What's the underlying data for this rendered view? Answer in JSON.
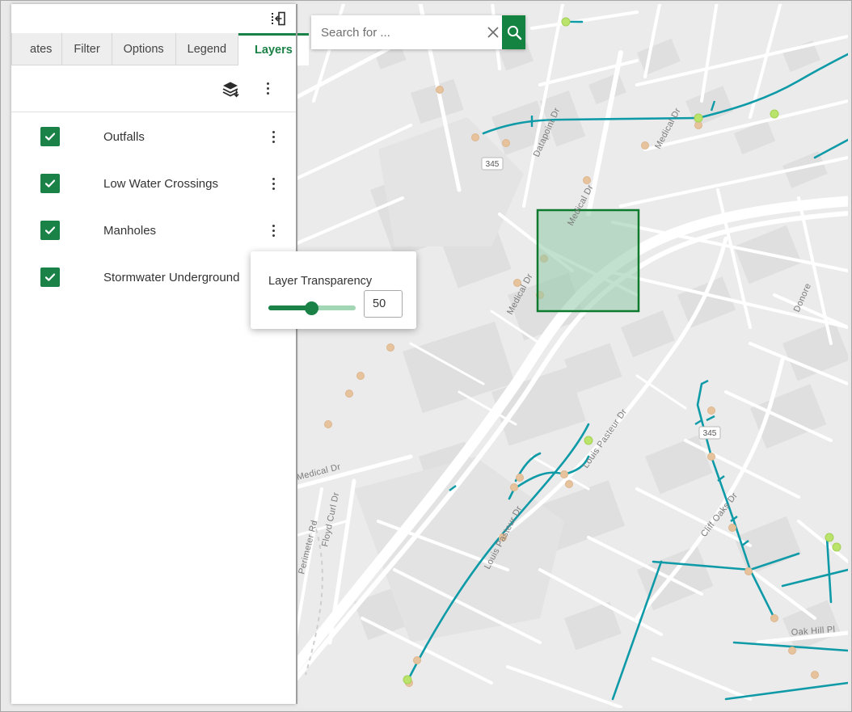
{
  "window": {
    "title": ""
  },
  "panel": {
    "collapse_icon": "collapse-panel-icon",
    "tabs": [
      {
        "label": "ates",
        "active": false,
        "partial": true
      },
      {
        "label": "Filter",
        "active": false
      },
      {
        "label": "Options",
        "active": false
      },
      {
        "label": "Legend",
        "active": false
      },
      {
        "label": "Layers",
        "active": true
      }
    ],
    "scroll_left_icon": "chevron-left-icon",
    "toolbar": {
      "add_layers_icon": "layers-add-icon",
      "overflow_icon": "more-vertical-icon"
    },
    "layers": [
      {
        "label": "Outfalls",
        "checked": true
      },
      {
        "label": "Low Water Crossings",
        "checked": true
      },
      {
        "label": "Manholes",
        "checked": true
      },
      {
        "label": "Stormwater Underground",
        "checked": true
      }
    ]
  },
  "transparency_popup": {
    "title": "Layer Transparency",
    "value": "50",
    "slider_percent": 50
  },
  "search": {
    "value": "",
    "placeholder": "Search for ...",
    "clear_icon": "close-icon",
    "search_icon": "search-icon"
  },
  "map": {
    "basemap_color": "#ebebeb",
    "road_color": "#ffffff",
    "building_color": "#dedede",
    "pipe_color": "#0f9aa8",
    "outfall_color": "#b5e26a",
    "manhole_color": "#e8c29a",
    "selection_border": "#0d7a2e",
    "selection_fill": "#8fc9a6",
    "road_labels": [
      "Datapoint Dr",
      "Medical Dr",
      "Medical Dr",
      "Medical Dr",
      "Louis Pasteur Dr",
      "Louis Pasteur Dr",
      "Cliff Oaks Dr",
      "Floyd Curl Dr",
      "Perimeter Rd",
      "Oak Hill Pl",
      "Donore"
    ],
    "route_shields": [
      "345",
      "345"
    ]
  },
  "colors": {
    "accent_green": "#1a8247",
    "search_button_green": "#148240",
    "tab_inactive_bg": "#eeeeee",
    "panel_bg": "#ffffff"
  }
}
